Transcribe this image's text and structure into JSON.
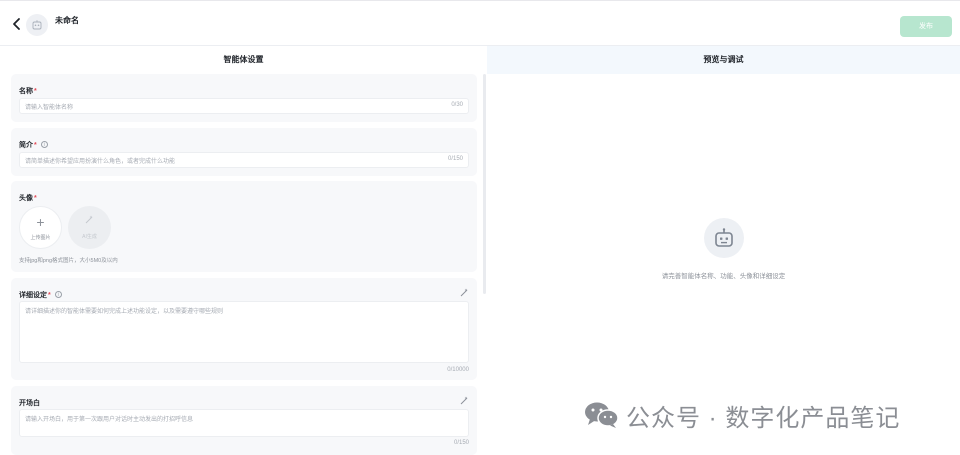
{
  "topbar": {
    "agent_name": "未命名",
    "publish_label": "发布"
  },
  "left": {
    "title": "智能体设置",
    "name_section": {
      "label": "名称",
      "placeholder": "请输入智能体名称",
      "counter": "0/30"
    },
    "intro_section": {
      "label": "简介",
      "placeholder": "请简单描述你希望应用扮演什么角色，或者完成什么功能",
      "counter": "0/150"
    },
    "avatar_section": {
      "label": "头像",
      "upload_label": "上传图片",
      "generate_label": "AI生成",
      "hint": "支持jpg和png格式图片，大小5M0及以内"
    },
    "detail_section": {
      "label": "详细设定",
      "placeholder": "请详细描述你的智能体需要如何完成上述功能设定，以及需要遵守哪些规则",
      "counter": "0/10000"
    },
    "opening_section": {
      "label": "开场白",
      "placeholder": "请输入开场白，用于第一次跟用户对话时主动发出的打招呼信息",
      "counter": "0/150"
    }
  },
  "right": {
    "title": "预览与调试",
    "empty_hint": "请完善智能体名称、功能、头像和详细设定"
  },
  "watermark": {
    "text": "公众号 · 数字化产品笔记"
  },
  "colors": {
    "publish_disabled": "#b7e6cf",
    "required_mark": "#e34d59",
    "panel_header_bg": "#f3f8fd",
    "card_bg": "#f7f8fa"
  }
}
